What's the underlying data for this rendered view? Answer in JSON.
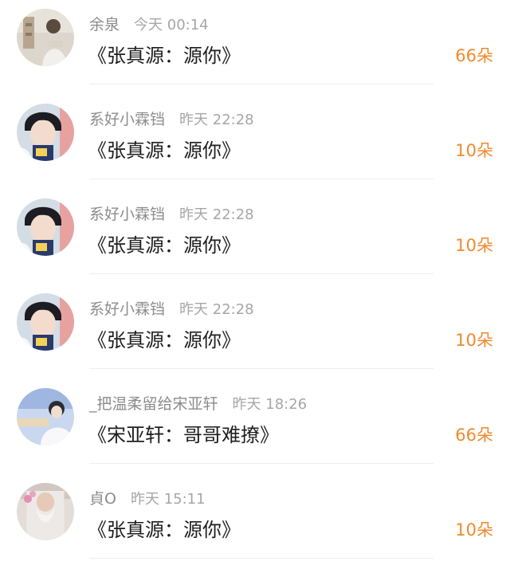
{
  "records": [
    {
      "user": "余泉",
      "time": "今天 00:14",
      "song": "《张真源：源你》",
      "gift": "66朵",
      "avatar_icon": "avatar-photo-icon"
    },
    {
      "user": "系好小霖铛",
      "time": "昨天 22:28",
      "song": "《张真源：源你》",
      "gift": "10朵",
      "avatar_icon": "avatar-photo-icon"
    },
    {
      "user": "系好小霖铛",
      "time": "昨天 22:28",
      "song": "《张真源：源你》",
      "gift": "10朵",
      "avatar_icon": "avatar-photo-icon"
    },
    {
      "user": "系好小霖铛",
      "time": "昨天 22:28",
      "song": "《张真源：源你》",
      "gift": "10朵",
      "avatar_icon": "avatar-photo-icon"
    },
    {
      "user": "_把温柔留给宋亚轩",
      "time": "昨天 18:26",
      "song": "《宋亚轩：哥哥难撩》",
      "gift": "66朵",
      "avatar_icon": "avatar-photo-icon"
    },
    {
      "user": "貞O",
      "time": "昨天 15:11",
      "song": "《张真源：源你》",
      "gift": "10朵",
      "avatar_icon": "avatar-photo-icon"
    }
  ],
  "colors": {
    "gift": "#f08a2e",
    "username": "#8c8c8c",
    "timestamp": "#a6a6a6",
    "song": "#1e1e1e",
    "divider": "#eeeeee"
  }
}
